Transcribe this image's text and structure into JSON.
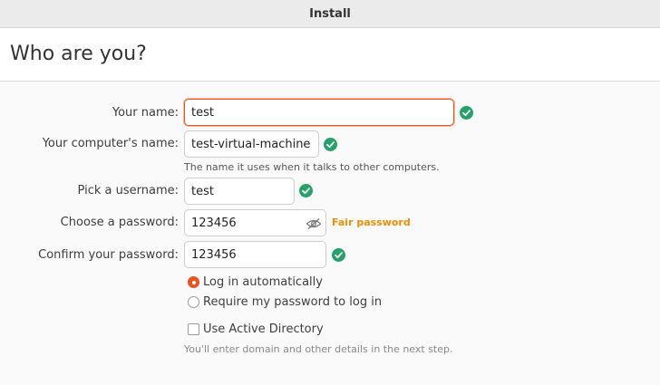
{
  "window": {
    "title": "Install"
  },
  "page": {
    "heading": "Who are you?"
  },
  "form": {
    "name": {
      "label": "Your name:",
      "value": "test",
      "valid": true
    },
    "computer_name": {
      "label": "Your computer's name:",
      "value": "test-virtual-machine",
      "hint": "The name it uses when it talks to other computers.",
      "valid": true
    },
    "username": {
      "label": "Pick a username:",
      "value": "test",
      "valid": true
    },
    "password": {
      "label": "Choose a password:",
      "value": "123456",
      "strength": "Fair password",
      "visibility_icon": "eye-slash-icon"
    },
    "confirm_password": {
      "label": "Confirm your password:",
      "value": "123456",
      "valid": true
    },
    "login_options": [
      {
        "label": "Log in automatically",
        "selected": true
      },
      {
        "label": "Require my password to log in",
        "selected": false
      }
    ],
    "active_directory": {
      "label": "Use Active Directory",
      "checked": false,
      "hint": "You'll enter domain and other details in the next step."
    }
  },
  "colors": {
    "accent": "#E95420",
    "valid": "#26A269",
    "warning": "#F08C00"
  }
}
